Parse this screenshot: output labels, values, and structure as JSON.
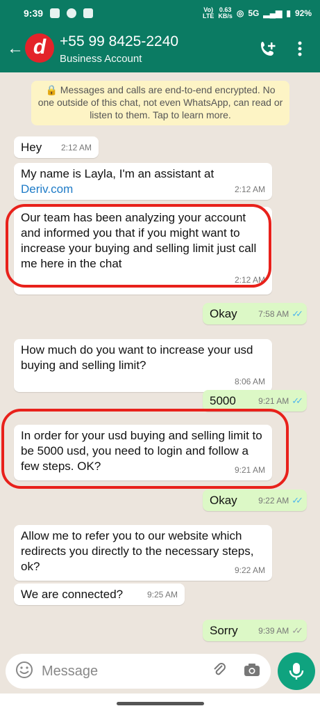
{
  "status_bar": {
    "time": "9:39",
    "net_speed": "0.63\nKB/s",
    "network": "5G",
    "battery": "92%"
  },
  "header": {
    "back_icon": "arrow-left-icon",
    "avatar_letter": "d",
    "title": "+55 99 8425-2240",
    "subtitle": "Business Account"
  },
  "encryption_notice": "Messages and calls are end-to-end encrypted. No one outside of this chat, not even WhatsApp, can read or listen to them. Tap to learn more.",
  "messages": [
    {
      "text": "Hey",
      "time": "2:12 AM"
    },
    {
      "text": "My name is Layla, I'm an assistant at",
      "link": "Deriv.com",
      "time": "2:12 AM"
    },
    {
      "text": "Our team has been analyzing your account and informed you that if you might want to increase your buying and selling limit just call me here in the chat",
      "time": "2:12 AM"
    },
    {
      "text": "Okay",
      "time": "7:58 AM"
    },
    {
      "text": "How much do you want to increase your usd buying and selling limit?",
      "time": "8:06 AM"
    },
    {
      "text": "5000",
      "time": "9:21 AM"
    },
    {
      "text": "In order for your usd buying and selling limit to be 5000 usd, you need to login and follow a few steps. OK?",
      "time": "9:21 AM"
    },
    {
      "text": "Okay",
      "time": "9:22 AM"
    },
    {
      "text": "Allow me to refer you to our website which redirects you directly to the necessary steps, ok?",
      "time": "9:22 AM"
    },
    {
      "text": "We are connected?",
      "time": "9:25 AM"
    },
    {
      "text": "Sorry",
      "time": "9:39 AM"
    }
  ],
  "composer": {
    "placeholder": "Message"
  },
  "colors": {
    "header": "#0b7b63",
    "outgoing": "#dcf8c6",
    "highlight": "#e8211b",
    "mic": "#0fa37f"
  }
}
